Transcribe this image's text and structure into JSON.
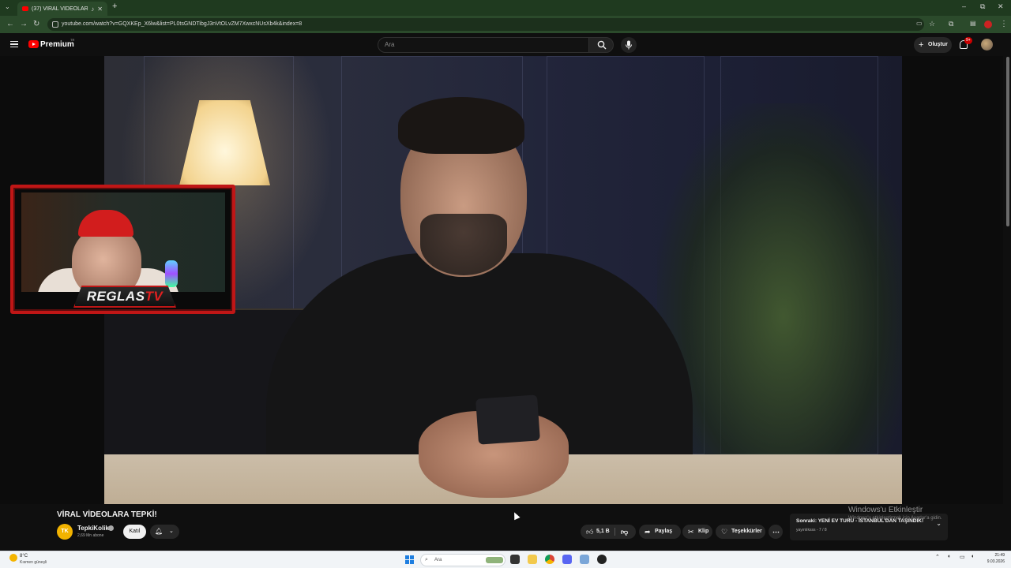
{
  "browser": {
    "tab_title": "(37) VİRAL VİDEOLARA TEPKİ",
    "url": "youtube.com/watch?v=GQXKEp_X6lw&list=PL0tsGNDTibgJ3nVtOLvZM7XwxcNUsXb4k&index=8",
    "window_controls": {
      "minimize": "–",
      "maximize": "⧉",
      "close": "✕"
    }
  },
  "yt_header": {
    "logo_text": "Premium",
    "country_code": "TR",
    "search_placeholder": "Ara",
    "create_label": "Oluştur",
    "notification_count": "9+"
  },
  "webcam": {
    "brand_main": "REGLAS",
    "brand_accent": "TV"
  },
  "video": {
    "title": "VİRAL VİDEOLARA TEPKİ!",
    "channel_name": "TepkiKolik",
    "channel_avatar_text": "TK",
    "subscribers": "2,69 Mn abone",
    "join_label": "Katıl",
    "like_count": "5,1 B",
    "share_label": "Paylaş",
    "clip_label": "Klip",
    "thanks_label": "Teşekkürler"
  },
  "up_next": {
    "title": "Sonraki: YENİ EV TURU - İSTANBUL'DAN TAŞINDIK!",
    "meta": "yayınlıksss - 7 / 8"
  },
  "windows_watermark": {
    "title": "Windows'u Etkinleştir",
    "subtitle": "Windows'u etkinleştirmek için Ayarlar'a gidin."
  },
  "taskbar": {
    "weather_temp": "8°C",
    "weather_desc": "Kısmen güneşli",
    "search_placeholder": "Ara",
    "time": "21:49",
    "date": "9.03.2026"
  },
  "colors": {
    "yt_red": "#ff0000",
    "browser_frame": "#2b4a2b",
    "page_bg": "#0f0f0f",
    "overlay_red": "#c01616"
  }
}
